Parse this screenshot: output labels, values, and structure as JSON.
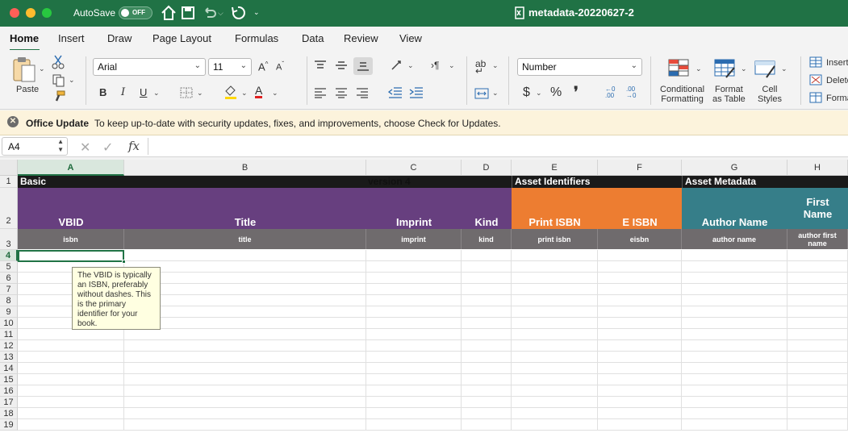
{
  "titlebar": {
    "autosave_label": "AutoSave",
    "autosave_state": "OFF",
    "doc_title": "metadata-20220627-2"
  },
  "tabs": [
    "Home",
    "Insert",
    "Draw",
    "Page Layout",
    "Formulas",
    "Data",
    "Review",
    "View"
  ],
  "ribbon": {
    "paste_label": "Paste",
    "font_name": "Arial",
    "font_size": "11",
    "number_format": "Number",
    "bold": "B",
    "italic": "I",
    "underline": "U",
    "currency": "$",
    "percent": "%",
    "comma": "❜",
    "cond_format_1": "Conditional",
    "cond_format_2": "Formatting",
    "format_table_1": "Format",
    "format_table_2": "as Table",
    "cell_styles_1": "Cell",
    "cell_styles_2": "Styles",
    "insert": "Insert",
    "delete": "Delete",
    "format": "Format"
  },
  "message_bar": {
    "title": "Office Update",
    "text": "To keep up-to-date with security updates, fixes, and improvements, choose Check for Updates."
  },
  "formula_bar": {
    "name_box": "A4",
    "fx": "fx",
    "cancel": "✕",
    "enter": "✓"
  },
  "sheet": {
    "columns": [
      "A",
      "B",
      "C",
      "D",
      "E",
      "F",
      "G",
      "H"
    ],
    "selected_column": "A",
    "selected_row": "4",
    "rows": [
      "1",
      "2",
      "3",
      "4",
      "5",
      "6",
      "7",
      "8",
      "9",
      "10",
      "11",
      "12",
      "13",
      "14",
      "15",
      "16",
      "17",
      "18",
      "19"
    ],
    "row1": {
      "basic": "Basic",
      "version": "version 4",
      "asset_identifiers": "Asset Identifiers",
      "asset_metadata": "Asset Metadata"
    },
    "row2": {
      "vbid": "VBID",
      "title": "Title",
      "imprint": "Imprint",
      "kind": "Kind",
      "print_isbn": "Print ISBN",
      "e_isbn": "E ISBN",
      "author_name": "Author Name",
      "first_name_1": "First",
      "first_name_2": "Name"
    },
    "row3": {
      "isbn": "isbn",
      "title": "title",
      "imprint": "imprint",
      "kind": "kind",
      "print_isbn": "print isbn",
      "eisbn": "eisbn",
      "author_name": "author name",
      "author_first_1": "author first",
      "author_first_2": "name"
    },
    "comment": "The VBID is typically an ISBN, preferably without dashes. This is the primary identifier for your book."
  },
  "colors": {
    "excel_green": "#207245",
    "purple": "#673f7f",
    "orange": "#ed7d31",
    "teal": "#367e89",
    "black_band": "#1a1a1a",
    "gray_band": "#6f6b6d"
  }
}
